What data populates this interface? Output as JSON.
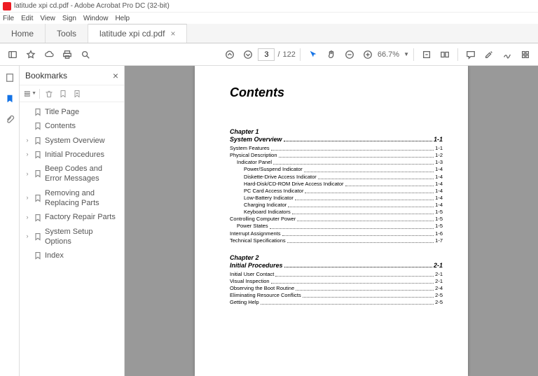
{
  "window": {
    "title": "latitude xpi cd.pdf - Adobe Acrobat Pro DC (32-bit)"
  },
  "menu": {
    "file": "File",
    "edit": "Edit",
    "view": "View",
    "sign": "Sign",
    "window": "Window",
    "help": "Help"
  },
  "tabs": {
    "home": "Home",
    "tools": "Tools",
    "doc": "latitude xpi cd.pdf"
  },
  "toolbar": {
    "page_current": "3",
    "page_sep": "/",
    "page_total": "122",
    "zoom": "66.7%"
  },
  "sidebar": {
    "title": "Bookmarks",
    "items": [
      {
        "label": "Title Page",
        "expandable": false
      },
      {
        "label": "Contents",
        "expandable": false
      },
      {
        "label": "System Overview",
        "expandable": true
      },
      {
        "label": "Initial Procedures",
        "expandable": true
      },
      {
        "label": "Beep Codes and Error Messages",
        "expandable": true
      },
      {
        "label": "Removing and Replacing Parts",
        "expandable": true
      },
      {
        "label": "Factory Repair Parts",
        "expandable": true
      },
      {
        "label": "System Setup Options",
        "expandable": true
      },
      {
        "label": "Index",
        "expandable": false
      }
    ]
  },
  "doc": {
    "heading": "Contents",
    "ch1": {
      "label": "Chapter 1",
      "title": "System Overview",
      "page": "1-1",
      "lines": [
        {
          "t": "System Features",
          "p": "1-1",
          "ind": 0
        },
        {
          "t": "Physical Description",
          "p": "1-2",
          "ind": 0
        },
        {
          "t": "Indicator Panel",
          "p": "1-3",
          "ind": 1
        },
        {
          "t": "Power/Suspend Indicator",
          "p": "1-4",
          "ind": 2
        },
        {
          "t": "Diskette-Drive Access Indicator",
          "p": "1-4",
          "ind": 2
        },
        {
          "t": "Hard-Disk/CD-ROM Drive Access Indicator",
          "p": "1-4",
          "ind": 2
        },
        {
          "t": "PC Card Access Indicator",
          "p": "1-4",
          "ind": 2
        },
        {
          "t": "Low-Battery Indicator",
          "p": "1-4",
          "ind": 2
        },
        {
          "t": "Charging Indicator",
          "p": "1-4",
          "ind": 2
        },
        {
          "t": "Keyboard Indicators",
          "p": "1-5",
          "ind": 2
        },
        {
          "t": "Controlling Computer Power",
          "p": "1-5",
          "ind": 0
        },
        {
          "t": "Power States",
          "p": "1-5",
          "ind": 1
        },
        {
          "t": "Interrupt Assignments",
          "p": "1-6",
          "ind": 0
        },
        {
          "t": "Technical Specifications",
          "p": "1-7",
          "ind": 0
        }
      ]
    },
    "ch2": {
      "label": "Chapter 2",
      "title": "Initial Procedures",
      "page": "2-1",
      "lines": [
        {
          "t": "Initial User Contact",
          "p": "2-1",
          "ind": 0
        },
        {
          "t": "Visual Inspection",
          "p": "2-1",
          "ind": 0
        },
        {
          "t": "Observing the Boot Routine",
          "p": "2-4",
          "ind": 0
        },
        {
          "t": "Eliminating Resource Conflicts",
          "p": "2-5",
          "ind": 0
        },
        {
          "t": "Getting Help",
          "p": "2-5",
          "ind": 0
        }
      ]
    }
  }
}
